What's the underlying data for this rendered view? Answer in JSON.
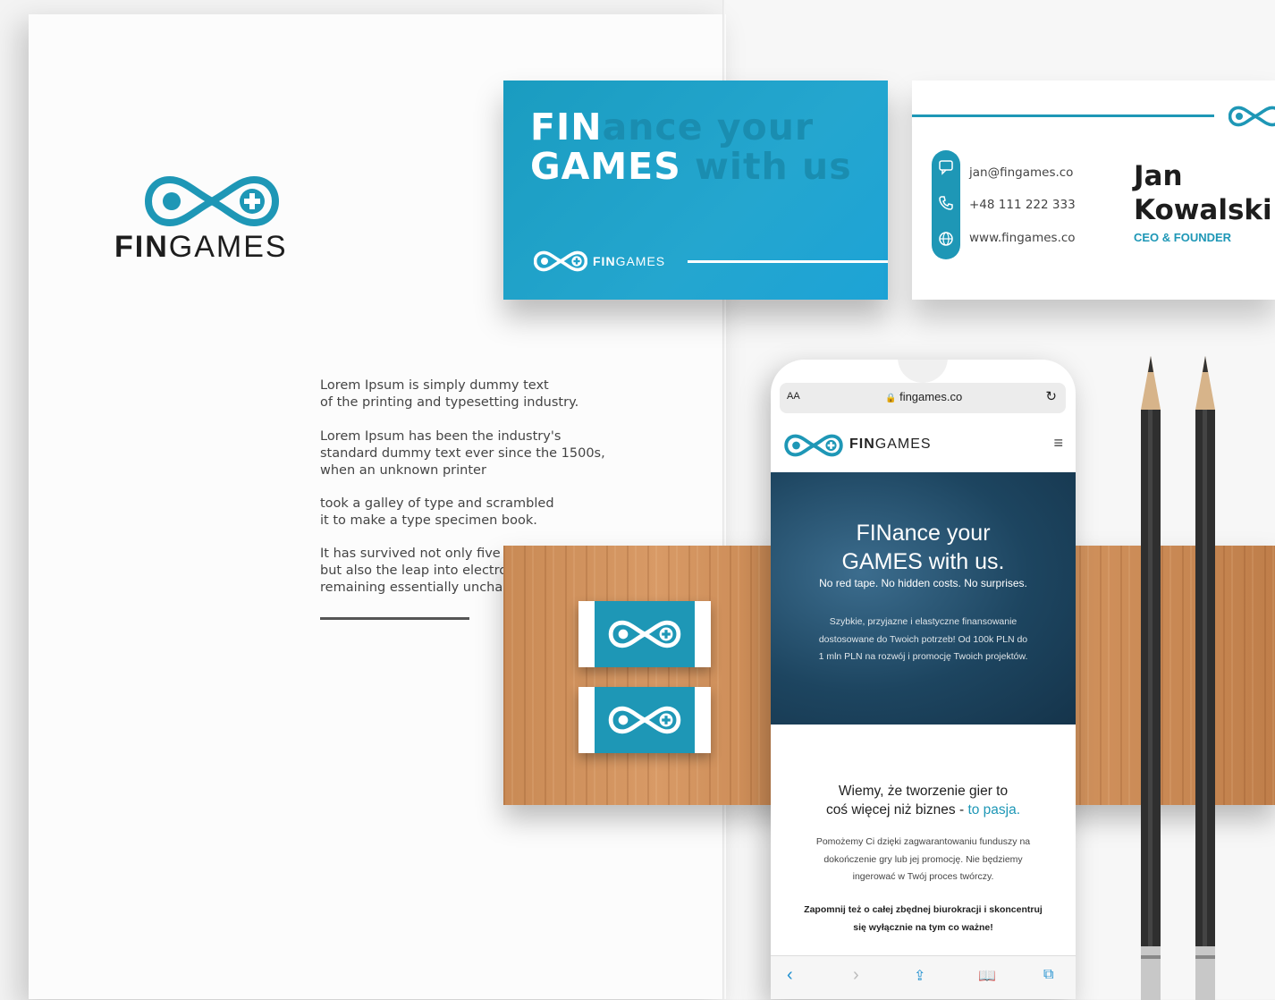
{
  "brand": {
    "name_bold": "FIN",
    "name_light": "GAMES",
    "primary_color": "#1e97b6",
    "logo_icon": "gamepad-infinity-icon"
  },
  "brochure": {
    "paragraphs": [
      [
        "Lorem Ipsum is simply dummy text",
        "of the printing and typesetting industry."
      ],
      [
        "Lorem Ipsum has been the industry's",
        "standard dummy text ever since the 1500s,",
        "when an unknown printer"
      ],
      [
        "took a galley of type and scrambled",
        "it to make a type specimen book."
      ],
      [
        "It has survived not only five c",
        "but also the leap into electro",
        "remaining essentially uncha"
      ]
    ]
  },
  "blue_card": {
    "line1_bold": "FIN",
    "line1_rest": "ance your",
    "line2_bold": "GAMES",
    "line2_rest": " with us"
  },
  "white_card": {
    "email": "jan@fingames.co",
    "phone": "+48 111 222 333",
    "website": "www.fingames.co",
    "first_name": "Jan",
    "last_name": "Kowalski",
    "role": "CEO & FOUNDER"
  },
  "phone": {
    "text_size_label": "AA",
    "url": "fingames.co",
    "hero_title_line1": "FINance your",
    "hero_title_line2": "GAMES with us.",
    "hero_subtitle": "No red tape. No hidden costs. No surprises.",
    "hero_body": [
      "Szybkie, przyjazne i elastyczne finansowanie",
      "dostosowane do Twoich potrzeb! Od 100k PLN do",
      "1 mln PLN na rozwój i promocję Twoich projektów."
    ],
    "section_title_line1": "Wiemy, że tworzenie gier to",
    "section_title_line2": "coś więcej niż biznes - ",
    "section_title_accent": "to pasja.",
    "section_body": [
      "Pomożemy Ci dzięki zagwarantowaniu funduszy na",
      "dokończenie gry lub jej promocję. Nie będziemy",
      "ingerować w Twój proces twórczy."
    ],
    "section_bold": [
      "Zapomnij też o całej zbędnej biurokracji i skoncentruj",
      "się wyłącznie na tym co ważne!"
    ]
  }
}
